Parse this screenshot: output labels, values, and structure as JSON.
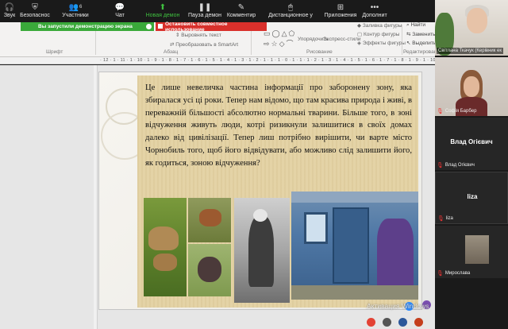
{
  "toolbar": {
    "items": [
      {
        "label": "Звук",
        "icon": "headphones-icon"
      },
      {
        "label": "Безопаснос",
        "icon": "shield-icon"
      },
      {
        "label": "Участники",
        "icon": "participants-icon",
        "count": "6"
      },
      {
        "label": "Чат",
        "icon": "chat-icon"
      },
      {
        "label": "Новая демон",
        "icon": "share-screen-icon"
      },
      {
        "label": "Пауза демон",
        "icon": "pause-icon"
      },
      {
        "label": "Комментир",
        "icon": "annotate-icon"
      },
      {
        "label": "Дистанционное у",
        "icon": "remote-control-icon"
      },
      {
        "label": "Приложения",
        "icon": "apps-icon"
      },
      {
        "label": "Дополнит",
        "icon": "more-icon"
      }
    ]
  },
  "banners": {
    "sharing": "Вы запустили демонстрацию экрана",
    "stop": "Остановить совместное использование"
  },
  "ribbon": {
    "groups": [
      "Шрифт",
      "Абзац",
      "Рисование",
      "Редактирование"
    ],
    "items": {
      "align_text": "Выровнять текст",
      "smartart": "Преобразовать в SmartArt",
      "arrange": "Упорядочить",
      "quick_styles": "Экспресс-стили",
      "fill": "Заливка фигуры",
      "outline": "Контур фигуры",
      "effects": "Эффекты фигуры",
      "find": "Найти",
      "replace": "Заменить",
      "select": "Выделить"
    }
  },
  "ruler": {
    "text": "· 12 · 1 · 11 · 1 · 10 · 1 · 9 · 1 · 8 · 1 · 7 · 1 · 6 · 1 · 5 · 1 · 4 · 1 · 3 · 1 · 2 · 1 · 1 · 1 · 0 · 1 · 1 · 1 · 2 · 1 · 3 · 1 · 4 · 1 · 5 · 1 · 6 · 1 · 7 · 1 · 8 · 1 · 9 · 1 · 10 · 1 · 11 · 1 · 12 ·"
  },
  "slide": {
    "text": "Це лише невеличка частина інформації про заборонену зону, яка збиралася усі ці роки. Тепер нам відомо, що там красива природа і живі, в переважній більшості абсолютно нормальні тварини. Більше того, в зоні відчуження живуть люди, котрі ризикнули залишитися в своїх домах далеко від цивілізації. Тепер лиш потрібно вирішити, чи варте місто   Чорнобиль того, щоб його відвідувати, або можливо слід залишити його, як годиться, зоною відчуження?"
  },
  "watermark": "Активация Windows",
  "participants": [
    {
      "name": "Світлана Ткачук (Керівник ек"
    },
    {
      "name": "Софія Барбер"
    },
    {
      "name": "Влад Огієвич",
      "display": "Влад Огієвич"
    },
    {
      "name": "liza",
      "display": "liza"
    },
    {
      "name": "Мирослава"
    }
  ]
}
